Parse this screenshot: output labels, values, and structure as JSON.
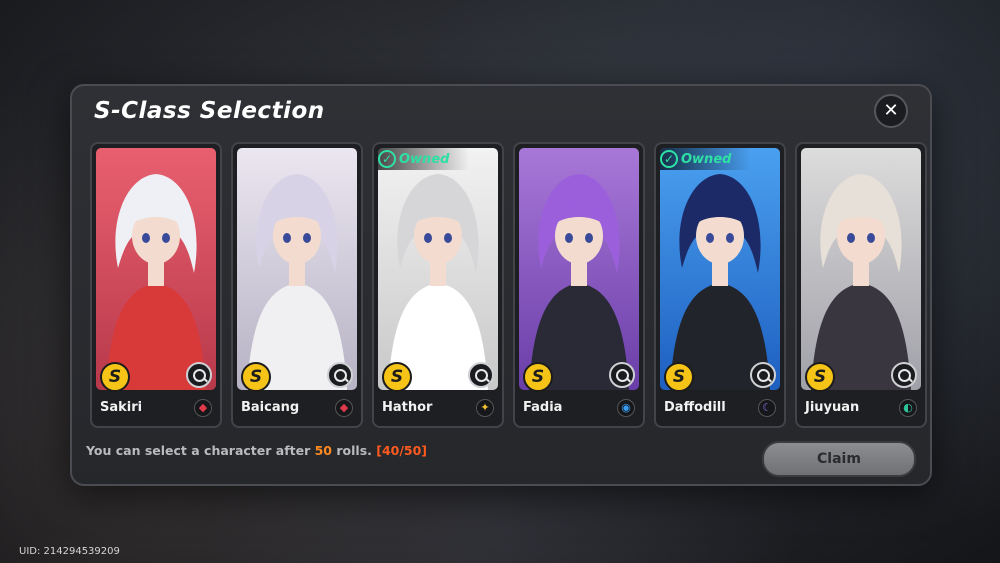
{
  "dialog": {
    "title": "S-Class Selection",
    "close_icon_char": "✕",
    "info_prefix": "You can select a character after ",
    "info_highlight": "50",
    "info_suffix": " rolls. ",
    "info_counter": "[40/50]",
    "claim_label": "Claim"
  },
  "owned_label": "Owned",
  "rank_label": "S",
  "characters": [
    {
      "name": "Sakiri",
      "owned": false,
      "bg": [
        "#e86070",
        "#b8394a"
      ],
      "hair": "#eef0f5",
      "outfit": "#d83a3a",
      "element_color": "#e03a4a",
      "element_glyph": "◆"
    },
    {
      "name": "Baicang",
      "owned": false,
      "bg": [
        "#ebe6f0",
        "#b7b2c4"
      ],
      "hair": "#d8d2e6",
      "outfit": "#f0f0f2",
      "element_color": "#e03a4a",
      "element_glyph": "◆"
    },
    {
      "name": "Hathor",
      "owned": true,
      "bg": [
        "#f2f2f2",
        "#c8c8c8"
      ],
      "hair": "#d6d6d8",
      "outfit": "#ffffff",
      "element_color": "#f2c230",
      "element_glyph": "✦"
    },
    {
      "name": "Fadia",
      "owned": false,
      "bg": [
        "#a878d8",
        "#6a3ea8"
      ],
      "hair": "#9b5fdc",
      "outfit": "#2a2a36",
      "element_color": "#3a9cf0",
      "element_glyph": "◉"
    },
    {
      "name": "Daffodill",
      "owned": true,
      "bg": [
        "#4aa0f0",
        "#1e5fc0"
      ],
      "hair": "#1c2a68",
      "outfit": "#22242c",
      "element_color": "#8a6ae0",
      "element_glyph": "☾"
    },
    {
      "name": "Jiuyuan",
      "owned": false,
      "bg": [
        "#dcdcdc",
        "#a0a0a8"
      ],
      "hair": "#e6e0d8",
      "outfit": "#3a3640",
      "element_color": "#2ec49a",
      "element_glyph": "◐"
    }
  ],
  "footer": {
    "uid": "UID: 214294539209"
  }
}
